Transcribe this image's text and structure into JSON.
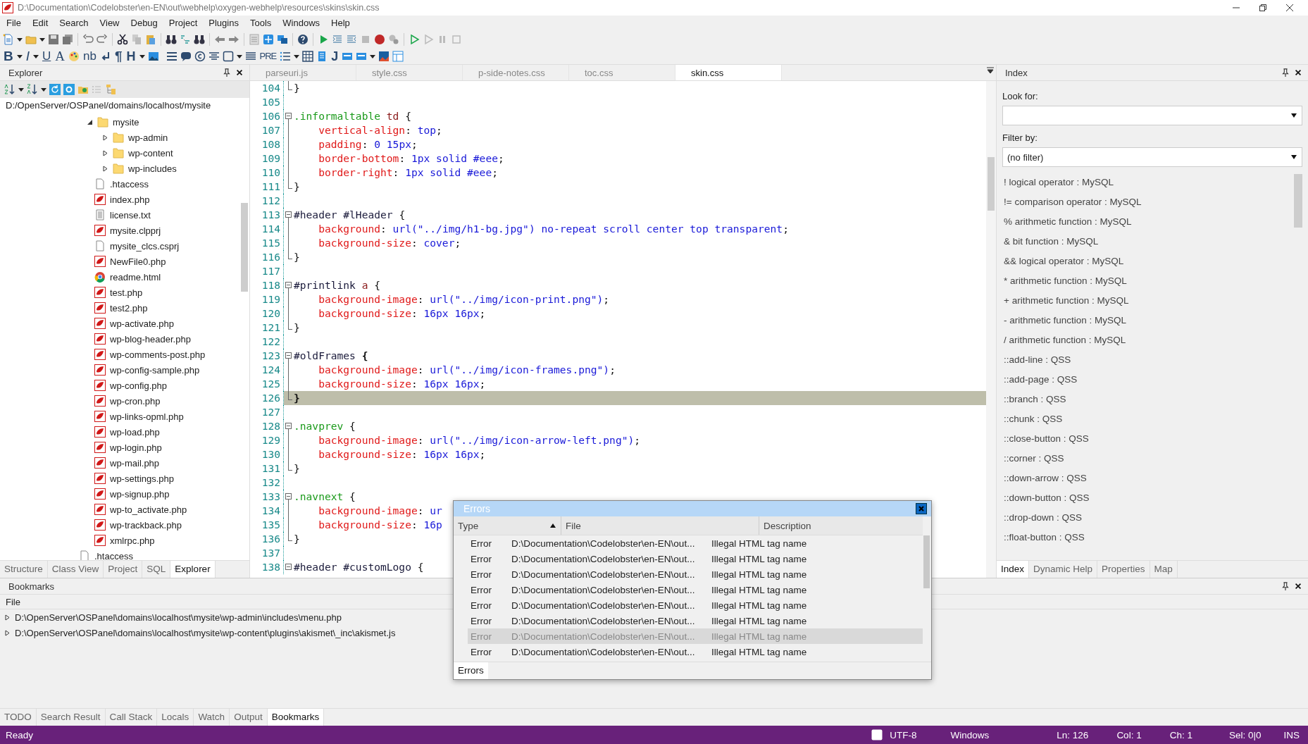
{
  "window": {
    "title": "D:\\Documentation\\Codelobster\\en-EN\\out\\webhelp\\oxygen-webhelp\\resources\\skins\\skin.css"
  },
  "menu": [
    "File",
    "Edit",
    "Search",
    "View",
    "Debug",
    "Project",
    "Plugins",
    "Tools",
    "Windows",
    "Help"
  ],
  "format_toolbar": [
    "B",
    "I",
    "U",
    "A",
    "nb",
    "¶",
    "H",
    "PRE",
    "J"
  ],
  "explorer": {
    "title": "Explorer",
    "path": "D:/OpenServer/OSPanel/domains/localhost/mysite",
    "tree": [
      {
        "label": "mysite",
        "kind": "folder",
        "expanded": true,
        "children": [
          {
            "label": "wp-admin",
            "kind": "folder",
            "expanded": false
          },
          {
            "label": "wp-content",
            "kind": "folder",
            "expanded": false
          },
          {
            "label": "wp-includes",
            "kind": "folder",
            "expanded": false
          },
          {
            "label": ".htaccess",
            "kind": "file"
          },
          {
            "label": "index.php",
            "kind": "php"
          },
          {
            "label": "license.txt",
            "kind": "text"
          },
          {
            "label": "mysite.clpprj",
            "kind": "php"
          },
          {
            "label": "mysite_clcs.csprj",
            "kind": "file"
          },
          {
            "label": "NewFile0.php",
            "kind": "php"
          },
          {
            "label": "readme.html",
            "kind": "web"
          },
          {
            "label": "test.php",
            "kind": "php"
          },
          {
            "label": "test2.php",
            "kind": "php"
          },
          {
            "label": "wp-activate.php",
            "kind": "php"
          },
          {
            "label": "wp-blog-header.php",
            "kind": "php"
          },
          {
            "label": "wp-comments-post.php",
            "kind": "php"
          },
          {
            "label": "wp-config-sample.php",
            "kind": "php"
          },
          {
            "label": "wp-config.php",
            "kind": "php"
          },
          {
            "label": "wp-cron.php",
            "kind": "php"
          },
          {
            "label": "wp-links-opml.php",
            "kind": "php"
          },
          {
            "label": "wp-load.php",
            "kind": "php"
          },
          {
            "label": "wp-login.php",
            "kind": "php"
          },
          {
            "label": "wp-mail.php",
            "kind": "php"
          },
          {
            "label": "wp-settings.php",
            "kind": "php"
          },
          {
            "label": "wp-signup.php",
            "kind": "php"
          },
          {
            "label": "wp-to_activate.php",
            "kind": "php"
          },
          {
            "label": "wp-trackback.php",
            "kind": "php"
          },
          {
            "label": "xmlrpc.php",
            "kind": "php"
          }
        ]
      },
      {
        "label": ".htaccess",
        "kind": "file"
      }
    ],
    "tabs": [
      {
        "label": "Structure",
        "selected": false
      },
      {
        "label": "Class View",
        "selected": false
      },
      {
        "label": "Project",
        "selected": false
      },
      {
        "label": "SQL",
        "selected": false
      },
      {
        "label": "Explorer",
        "selected": true
      }
    ]
  },
  "editor": {
    "tabs": [
      {
        "label": "parseuri.js",
        "selected": false
      },
      {
        "label": "style.css",
        "selected": false
      },
      {
        "label": "p-side-notes.css",
        "selected": false
      },
      {
        "label": "toc.css",
        "selected": false
      },
      {
        "label": "skin.css",
        "selected": true
      }
    ],
    "lines": [
      {
        "number": "104",
        "block_end": true,
        "current": false,
        "tokens": [
          {
            "kind": "punct",
            "text": "}"
          }
        ]
      },
      {
        "number": "105",
        "current": false
      },
      {
        "number": "106",
        "expanded": true,
        "current": false,
        "tokens": [
          {
            "kind": "class",
            "text": ".informaltable"
          },
          {
            "kind": "tag",
            "text": " td"
          },
          {
            "kind": "punct",
            "text": " {"
          }
        ],
        "children": [
          {
            "number": "107",
            "current": false,
            "tokens": [
              {
                "kind": "prop",
                "text": "    vertical-align"
              },
              {
                "kind": "punct",
                "text": ": "
              },
              {
                "kind": "value",
                "text": "top"
              },
              {
                "kind": "punct",
                "text": ";"
              }
            ]
          },
          {
            "number": "108",
            "current": false,
            "tokens": [
              {
                "kind": "prop",
                "text": "    padding"
              },
              {
                "kind": "punct",
                "text": ": "
              },
              {
                "kind": "value",
                "text": "0 15px"
              },
              {
                "kind": "punct",
                "text": ";"
              }
            ]
          },
          {
            "number": "109",
            "current": false,
            "tokens": [
              {
                "kind": "prop",
                "text": "    border-bottom"
              },
              {
                "kind": "punct",
                "text": ": "
              },
              {
                "kind": "value",
                "text": "1px solid #eee"
              },
              {
                "kind": "punct",
                "text": ";"
              }
            ]
          },
          {
            "number": "110",
            "current": false,
            "tokens": [
              {
                "kind": "prop",
                "text": "    border-right"
              },
              {
                "kind": "punct",
                "text": ": "
              },
              {
                "kind": "value",
                "text": "1px solid #eee"
              },
              {
                "kind": "punct",
                "text": ";"
              }
            ]
          },
          {
            "number": "111",
            "current": false,
            "tokens": [
              {
                "kind": "punct",
                "text": "}"
              }
            ]
          }
        ]
      },
      {
        "number": "112",
        "current": false
      },
      {
        "number": "113",
        "expanded": true,
        "current": false,
        "tokens": [
          {
            "kind": "id",
            "text": "#header #lHeader"
          },
          {
            "kind": "punct",
            "text": " {"
          }
        ],
        "children": [
          {
            "number": "114",
            "current": false,
            "tokens": [
              {
                "kind": "prop",
                "text": "    background"
              },
              {
                "kind": "punct",
                "text": ": "
              },
              {
                "kind": "value",
                "text": "url(\"../img/h1-bg.jpg\") no-repeat scroll center top transparent"
              },
              {
                "kind": "punct",
                "text": ";"
              }
            ]
          },
          {
            "number": "115",
            "current": false,
            "tokens": [
              {
                "kind": "prop",
                "text": "    background-size"
              },
              {
                "kind": "punct",
                "text": ": "
              },
              {
                "kind": "value",
                "text": "cover"
              },
              {
                "kind": "punct",
                "text": ";"
              }
            ]
          },
          {
            "number": "116",
            "current": false,
            "tokens": [
              {
                "kind": "punct",
                "text": "}"
              }
            ]
          }
        ]
      },
      {
        "number": "117",
        "current": false
      },
      {
        "number": "118",
        "expanded": true,
        "current": false,
        "tokens": [
          {
            "kind": "id",
            "text": "#printlink"
          },
          {
            "kind": "tag",
            "text": " a"
          },
          {
            "kind": "punct",
            "text": " {"
          }
        ],
        "children": [
          {
            "number": "119",
            "current": false,
            "tokens": [
              {
                "kind": "prop",
                "text": "    background-image"
              },
              {
                "kind": "punct",
                "text": ": "
              },
              {
                "kind": "value",
                "text": "url(\"../img/icon-print.png\")"
              },
              {
                "kind": "punct",
                "text": ";"
              }
            ]
          },
          {
            "number": "120",
            "current": false,
            "tokens": [
              {
                "kind": "prop",
                "text": "    background-size"
              },
              {
                "kind": "punct",
                "text": ": "
              },
              {
                "kind": "value",
                "text": "16px 16px"
              },
              {
                "kind": "punct",
                "text": ";"
              }
            ]
          },
          {
            "number": "121",
            "current": false,
            "tokens": [
              {
                "kind": "punct",
                "text": "}"
              }
            ]
          }
        ]
      },
      {
        "number": "122",
        "current": false
      },
      {
        "number": "123",
        "expanded": true,
        "current": false,
        "tokens": [
          {
            "kind": "id",
            "text": "#oldFrames"
          },
          {
            "kind": "brace",
            "text": " {"
          }
        ],
        "children": [
          {
            "number": "124",
            "current": false,
            "tokens": [
              {
                "kind": "prop",
                "text": "    background-image"
              },
              {
                "kind": "punct",
                "text": ": "
              },
              {
                "kind": "value",
                "text": "url(\"../img/icon-frames.png\")"
              },
              {
                "kind": "punct",
                "text": ";"
              }
            ]
          },
          {
            "number": "125",
            "current": false,
            "tokens": [
              {
                "kind": "prop",
                "text": "    background-size"
              },
              {
                "kind": "punct",
                "text": ": "
              },
              {
                "kind": "value",
                "text": "16px 16px"
              },
              {
                "kind": "punct",
                "text": ";"
              }
            ]
          },
          {
            "number": "126",
            "current": true,
            "tokens": [
              {
                "kind": "brace",
                "text": "}"
              }
            ]
          }
        ]
      },
      {
        "number": "127",
        "current": false
      },
      {
        "number": "128",
        "expanded": true,
        "current": false,
        "tokens": [
          {
            "kind": "class",
            "text": ".navprev"
          },
          {
            "kind": "punct",
            "text": " {"
          }
        ],
        "children": [
          {
            "number": "129",
            "current": false,
            "tokens": [
              {
                "kind": "prop",
                "text": "    background-image"
              },
              {
                "kind": "punct",
                "text": ": "
              },
              {
                "kind": "value",
                "text": "url(\"../img/icon-arrow-left.png\")"
              },
              {
                "kind": "punct",
                "text": ";"
              }
            ]
          },
          {
            "number": "130",
            "current": false,
            "tokens": [
              {
                "kind": "prop",
                "text": "    background-size"
              },
              {
                "kind": "punct",
                "text": ": "
              },
              {
                "kind": "value",
                "text": "16px 16px"
              },
              {
                "kind": "punct",
                "text": ";"
              }
            ]
          },
          {
            "number": "131",
            "current": false,
            "tokens": [
              {
                "kind": "punct",
                "text": "}"
              }
            ]
          }
        ]
      },
      {
        "number": "132",
        "current": false
      },
      {
        "number": "133",
        "expanded": true,
        "current": false,
        "tokens": [
          {
            "kind": "class",
            "text": ".navnext"
          },
          {
            "kind": "punct",
            "text": " {"
          }
        ],
        "children": [
          {
            "number": "134",
            "current": false,
            "tokens": [
              {
                "kind": "prop",
                "text": "    background-image"
              },
              {
                "kind": "punct",
                "text": ": "
              },
              {
                "kind": "value",
                "text": "ur"
              }
            ]
          },
          {
            "number": "135",
            "current": false,
            "tokens": [
              {
                "kind": "prop",
                "text": "    background-size"
              },
              {
                "kind": "punct",
                "text": ": "
              },
              {
                "kind": "value",
                "text": "16p"
              }
            ]
          },
          {
            "number": "136",
            "current": false,
            "tokens": [
              {
                "kind": "punct",
                "text": "}"
              }
            ]
          }
        ]
      },
      {
        "number": "137",
        "current": false
      },
      {
        "number": "138",
        "expanded": true,
        "current": false,
        "tokens": [
          {
            "kind": "id",
            "text": "#header #customLogo"
          },
          {
            "kind": "punct",
            "text": " {"
          }
        ]
      }
    ]
  },
  "index": {
    "title": "Index",
    "look_for_label": "Look for:",
    "filter_label": "Filter by:",
    "filter_value": "(no filter)",
    "items": [
      "! logical operator : MySQL",
      "!= comparison operator : MySQL",
      "% arithmetic function : MySQL",
      "& bit function : MySQL",
      "&& logical operator : MySQL",
      "* arithmetic function : MySQL",
      "+ arithmetic function : MySQL",
      "- arithmetic function : MySQL",
      "/ arithmetic function : MySQL",
      "::add-line : QSS",
      "::add-page : QSS",
      "::branch : QSS",
      "::chunk : QSS",
      "::close-button : QSS",
      "::corner : QSS",
      "::down-arrow : QSS",
      "::down-button : QSS",
      "::drop-down : QSS",
      "::float-button : QSS"
    ],
    "tabs": [
      {
        "label": "Index",
        "selected": true
      },
      {
        "label": "Dynamic Help",
        "selected": false
      },
      {
        "label": "Properties",
        "selected": false
      },
      {
        "label": "Map",
        "selected": false
      }
    ]
  },
  "bookmarks": {
    "title": "Bookmarks",
    "column": "File",
    "rows": [
      "D:\\OpenServer\\OSPanel\\domains\\localhost\\mysite\\wp-admin\\includes\\menu.php",
      "D:\\OpenServer\\OSPanel\\domains\\localhost\\mysite\\wp-content\\plugins\\akismet\\_inc\\akismet.js"
    ],
    "tabs": [
      {
        "label": "TODO",
        "selected": false
      },
      {
        "label": "Search Result",
        "selected": false
      },
      {
        "label": "Call Stack",
        "selected": false
      },
      {
        "label": "Locals",
        "selected": false
      },
      {
        "label": "Watch",
        "selected": false
      },
      {
        "label": "Output",
        "selected": false
      },
      {
        "label": "Bookmarks",
        "selected": true
      }
    ]
  },
  "errors_dialog": {
    "title": "Errors",
    "columns": [
      {
        "label": "Type",
        "sorted": true
      },
      {
        "label": "File",
        "sorted": false
      },
      {
        "label": "Description",
        "sorted": false
      }
    ],
    "rows": [
      {
        "type": "Error",
        "file": "D:\\Documentation\\Codelobster\\en-EN\\out...",
        "description": "Illegal HTML tag name",
        "selected": false
      },
      {
        "type": "Error",
        "file": "D:\\Documentation\\Codelobster\\en-EN\\out...",
        "description": "Illegal HTML tag name",
        "selected": false
      },
      {
        "type": "Error",
        "file": "D:\\Documentation\\Codelobster\\en-EN\\out...",
        "description": "Illegal HTML tag name",
        "selected": false
      },
      {
        "type": "Error",
        "file": "D:\\Documentation\\Codelobster\\en-EN\\out...",
        "description": "Illegal HTML tag name",
        "selected": false
      },
      {
        "type": "Error",
        "file": "D:\\Documentation\\Codelobster\\en-EN\\out...",
        "description": "Illegal HTML tag name",
        "selected": false
      },
      {
        "type": "Error",
        "file": "D:\\Documentation\\Codelobster\\en-EN\\out...",
        "description": "Illegal HTML tag name",
        "selected": false
      },
      {
        "type": "Error",
        "file": "D:\\Documentation\\Codelobster\\en-EN\\out...",
        "description": "Illegal HTML tag name",
        "selected": true
      },
      {
        "type": "Error",
        "file": "D:\\Documentation\\Codelobster\\en-EN\\out...",
        "description": "Illegal HTML tag name",
        "selected": false
      }
    ],
    "tab": "Errors"
  },
  "status_bar": {
    "message": "Ready",
    "encoding": "UTF-8",
    "line_endings": "Windows",
    "line": "Ln: 126",
    "column": "Col: 1",
    "char": "Ch: 1",
    "selection": "Sel: 0|0",
    "mode": "INS"
  }
}
